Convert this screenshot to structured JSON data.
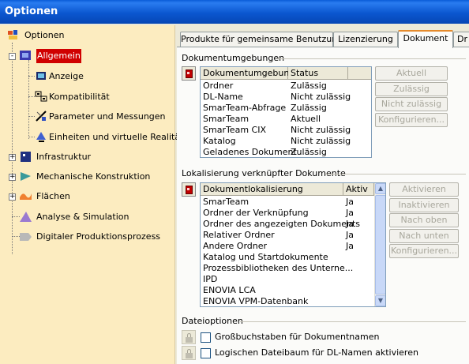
{
  "window": {
    "title": "Optionen"
  },
  "tree": {
    "root": "Optionen",
    "items": [
      {
        "label": "Allgemein",
        "icon": "general-icon",
        "selected": true
      },
      {
        "label": "Anzeige",
        "icon": "display-icon"
      },
      {
        "label": "Kompatibilität",
        "icon": "compatibility-icon"
      },
      {
        "label": "Parameter und Messungen",
        "icon": "parameters-icon"
      },
      {
        "label": "Einheiten und virtuelle Realität",
        "icon": "units-vr-icon"
      },
      {
        "label": "Infrastruktur",
        "icon": "infrastructure-icon"
      },
      {
        "label": "Mechanische Konstruktion",
        "icon": "mechanical-design-icon"
      },
      {
        "label": "Flächen",
        "icon": "surfaces-icon"
      },
      {
        "label": "Analyse & Simulation",
        "icon": "analysis-simulation-icon"
      },
      {
        "label": "Digitaler Produktionsprozess",
        "icon": "digital-production-icon"
      }
    ]
  },
  "tabs": [
    {
      "label": "Produkte für gemeinsame Benutzung"
    },
    {
      "label": "Lizenzierung"
    },
    {
      "label": "Dokument",
      "active": true
    },
    {
      "label": "Dr"
    }
  ],
  "env_group": {
    "title": "Dokumentumgebungen",
    "columns": [
      "Dokumentumgebung",
      "Status"
    ],
    "rows": [
      [
        "Ordner",
        "Zulässig"
      ],
      [
        "DL-Name",
        "Nicht zulässig"
      ],
      [
        "SmarTeam-Abfrage",
        "Zulässig"
      ],
      [
        "SmarTeam",
        "Aktuell"
      ],
      [
        "SmarTeam CIX",
        "Nicht zulässig"
      ],
      [
        "Katalog",
        "Nicht zulässig"
      ],
      [
        "Geladenes Dokument",
        "Zulässig"
      ]
    ],
    "buttons": [
      "Aktuell",
      "Zulässig",
      "Nicht zulässig",
      "Konfigurieren..."
    ]
  },
  "loc_group": {
    "title": "Lokalisierung verknüpfter Dokumente",
    "columns": [
      "Dokumentlokalisierung",
      "Aktiv"
    ],
    "rows": [
      [
        "SmarTeam",
        "Ja"
      ],
      [
        "Ordner der Verknüpfung",
        "Ja"
      ],
      [
        "Ordner des angezeigten Dokuments",
        "Ja"
      ],
      [
        "Relativer Ordner",
        "Ja"
      ],
      [
        "Andere Ordner",
        "Ja"
      ],
      [
        "Katalog und Startdokumente",
        ""
      ],
      [
        "Prozessbibliotheken des Unterne...",
        ""
      ],
      [
        "IPD",
        ""
      ],
      [
        "ENOVIA LCA",
        ""
      ],
      [
        "ENOVIA VPM-Datenbank",
        ""
      ]
    ],
    "buttons": [
      "Aktivieren",
      "Inaktivieren",
      "Nach oben",
      "Nach unten",
      "Konfigurieren..."
    ]
  },
  "file_group": {
    "title": "Dateioptionen",
    "options": [
      {
        "label": "Großbuchstaben für Dokumentnamen",
        "checked": false
      },
      {
        "label": "Logischen Dateibaum für DL-Namen aktivieren",
        "checked": false
      }
    ]
  },
  "colors": {
    "titlebar": "#0b57d0",
    "tree_bg": "#fcecc0",
    "selection": "#d00000",
    "tab_accent": "#e68b2c"
  }
}
